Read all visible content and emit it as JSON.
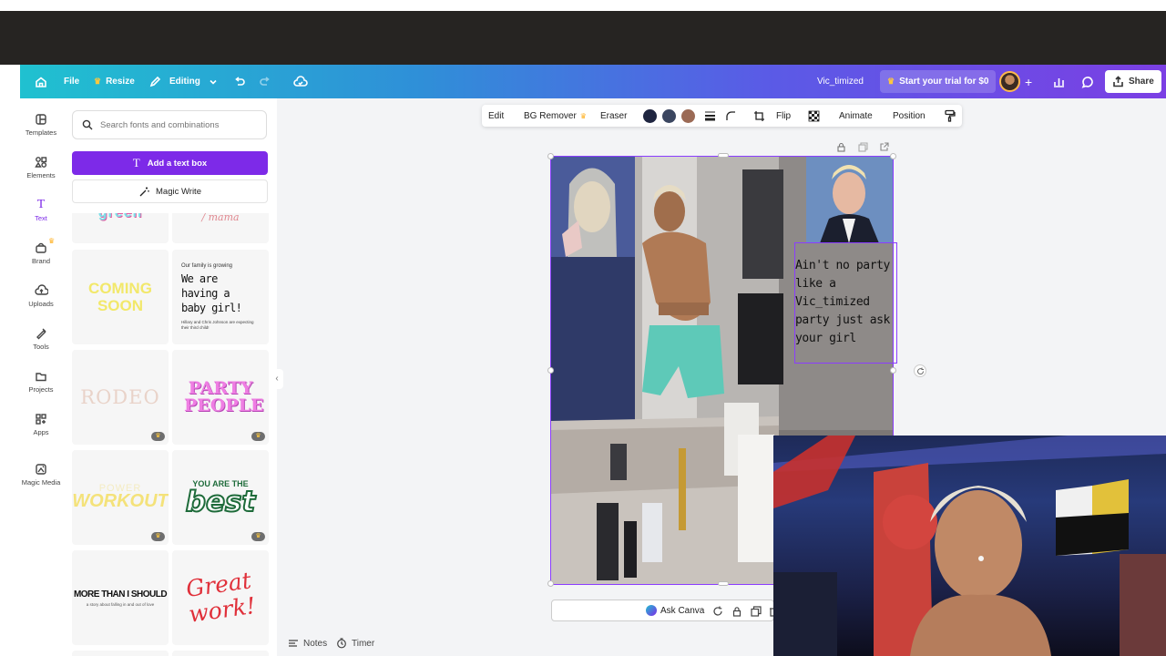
{
  "header": {
    "file_label": "File",
    "resize_label": "Resize",
    "editing_label": "Editing",
    "doc_title": "Vic_timized",
    "trial_label": "Start your trial for $0",
    "share_label": "Share"
  },
  "rail": [
    {
      "label": "Templates",
      "icon": "templates-icon"
    },
    {
      "label": "Elements",
      "icon": "elements-icon"
    },
    {
      "label": "Text",
      "icon": "text-icon"
    },
    {
      "label": "Brand",
      "icon": "brand-icon"
    },
    {
      "label": "Uploads",
      "icon": "uploads-icon"
    },
    {
      "label": "Tools",
      "icon": "tools-icon"
    },
    {
      "label": "Projects",
      "icon": "projects-icon"
    },
    {
      "label": "Apps",
      "icon": "apps-icon"
    },
    {
      "label": "Magic Media",
      "icon": "magic-media-icon"
    }
  ],
  "panel": {
    "search_placeholder": "Search fonts and combinations",
    "add_text_label": "Add a text box",
    "magic_write_label": "Magic Write",
    "templates": {
      "coming_soon": "COMING SOON",
      "baby_small": "Our family is growing",
      "baby_big": "We are having a baby girl!",
      "baby_tiny": "Hillary and Chris Johnson are expecting their third child!",
      "rodeo": "RODEO",
      "party_people": "PARTY PEOPLE",
      "power": "POWER",
      "workout": "WORKOUT",
      "you_are_the": "YOU ARE THE",
      "best": "best",
      "more_than": "MORE THAN I SHOULD",
      "more_than_sub": "a story about falling in and out of love",
      "great_work": "Great work!"
    }
  },
  "toolbar": {
    "edit": "Edit",
    "bg_remover": "BG Remover",
    "eraser": "Eraser",
    "flip": "Flip",
    "animate": "Animate",
    "position": "Position",
    "colors": [
      "#1f2540",
      "#3b4660",
      "#9b6a55"
    ]
  },
  "canvas": {
    "text": "Ain't no party like a Vic_timized party just ask your girl"
  },
  "bottom": {
    "notes": "Notes",
    "timer": "Timer",
    "ask_canva": "Ask Canva"
  },
  "colors": {
    "accent": "#7d2ae8",
    "selection": "#8b3dff"
  }
}
